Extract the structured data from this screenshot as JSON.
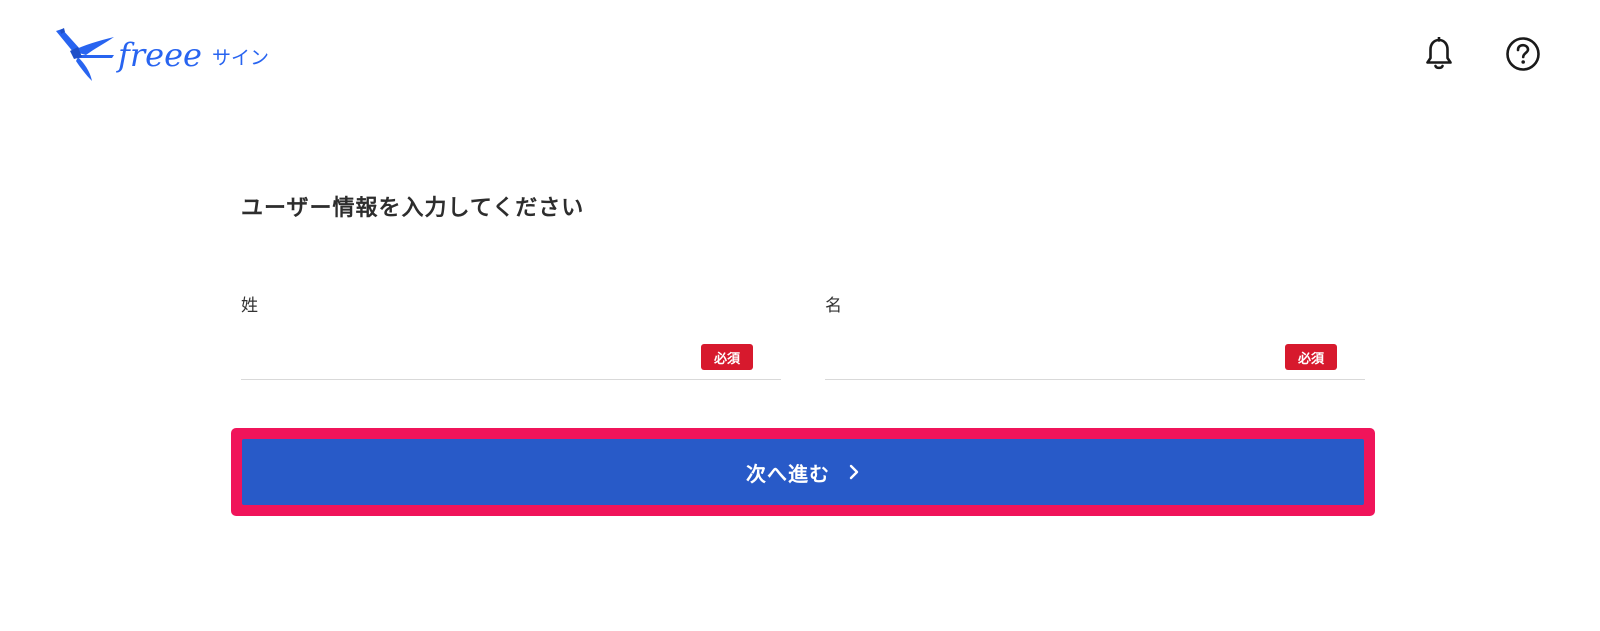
{
  "header": {
    "logo": {
      "brand": "freee",
      "product": "サイン"
    },
    "icons": {
      "notifications": "bell-icon",
      "help": "help-circle-icon"
    }
  },
  "main": {
    "title": "ユーザー情報を入力してください",
    "fields": {
      "last_name": {
        "label": "姓",
        "value": "",
        "required_badge": "必須"
      },
      "first_name": {
        "label": "名",
        "value": "",
        "required_badge": "必須"
      }
    },
    "next_button": {
      "label": "次へ進む",
      "icon": "chevron-right-icon"
    }
  },
  "colors": {
    "brand_blue": "#2864f0",
    "primary_button": "#285ac8",
    "required_badge": "#d7192d",
    "highlight_frame": "#f0145a"
  }
}
